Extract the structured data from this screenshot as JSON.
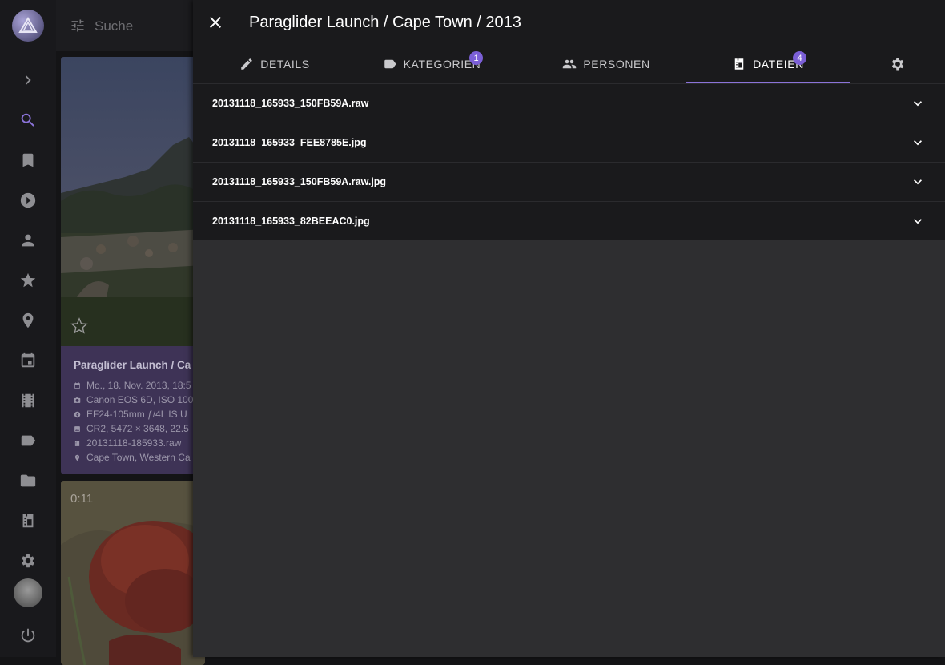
{
  "search": {
    "placeholder": "Suche"
  },
  "rail": {
    "items": [
      "expand-icon",
      "search-icon",
      "bookmark-icon",
      "play-icon",
      "person-icon",
      "star-icon",
      "place-icon",
      "calendar-icon",
      "film-icon",
      "label-icon",
      "folder-icon",
      "files-icon",
      "gear-icon",
      "power-icon"
    ],
    "active": "search-icon",
    "accent": "#8b73d9"
  },
  "card": {
    "title": "Paraglider Launch / Ca",
    "date": "Mo., 18. Nov. 2013, 18:5",
    "camera": "Canon EOS 6D, ISO 100",
    "lens": "EF24-105mm ƒ/4L IS U",
    "file_info": "CR2, 5472 × 3648, 22.5",
    "filename": "20131118-185933.raw",
    "location": "Cape Town, Western Ca"
  },
  "card2": {
    "duration": "0:11"
  },
  "panel": {
    "title": "Paraglider Launch / Cape Town / 2013",
    "tabs": [
      {
        "label": "DETAILS",
        "icon": "pencil-icon",
        "badge": ""
      },
      {
        "label": "KATEGORIEN",
        "icon": "label-icon",
        "badge": "1"
      },
      {
        "label": "PERSONEN",
        "icon": "people-icon",
        "badge": ""
      },
      {
        "label": "DATEIEN",
        "icon": "files-icon",
        "badge": "4"
      }
    ],
    "active_tab": "DATEIEN",
    "files": [
      "20131118_165933_150FB59A.raw",
      "20131118_165933_FEE8785E.jpg",
      "20131118_165933_150FB59A.raw.jpg",
      "20131118_165933_82BEEAC0.jpg"
    ]
  }
}
